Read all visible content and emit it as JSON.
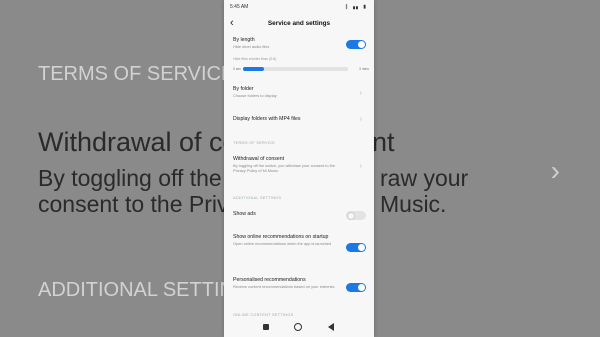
{
  "background": {
    "terms_heading": "TERMS OF SERVICE",
    "withdrawal_title": "Withdrawal of co",
    "withdrawal_right": "nt",
    "desc_line1": "By toggling off the s",
    "desc_line1_right": "raw your",
    "desc_line2": "consent to the Priva",
    "desc_line2_right": "Music.",
    "additional_heading": "ADDITIONAL SETTIN"
  },
  "status": {
    "time": "5:45 AM",
    "icons": "∥ ▗▖ ▮"
  },
  "header": {
    "title": "Service and settings"
  },
  "by_length": {
    "label": "By length",
    "sub": "Hide short audio files",
    "enabled": true
  },
  "slider": {
    "caption": "Hide files shorter than (0:6)",
    "min_label": "0 sec",
    "max_label": "3 mins",
    "fill_fraction": 0.2
  },
  "by_folder": {
    "label": "By folder",
    "sub": "Choose folders to display"
  },
  "display_mp4": {
    "label": "Display folders with MP4 files"
  },
  "terms": {
    "section": "TERMS OF SERVICE",
    "withdrawal_label": "Withdrawal of consent",
    "withdrawal_sub": "By toggling off the switch, you withdraw your consent to the Privacy Policy of Mi Music."
  },
  "additional": {
    "section": "ADDITIONAL SETTINGS",
    "show_ads_label": "Show ads",
    "show_ads_enabled": false,
    "online_rec_label": "Show online recommendations on startup",
    "online_rec_sub": "Open online recommendations when the app is launched",
    "online_rec_enabled": true,
    "personalised_label": "Personalised recommendations",
    "personalised_sub": "Receive content recommendations based on your interests",
    "personalised_enabled": true
  },
  "online_content_section": "ONLINE CONTENT SETTINGS",
  "colors": {
    "accent": "#1b78e5",
    "background_blur": "#8a8a8a"
  }
}
